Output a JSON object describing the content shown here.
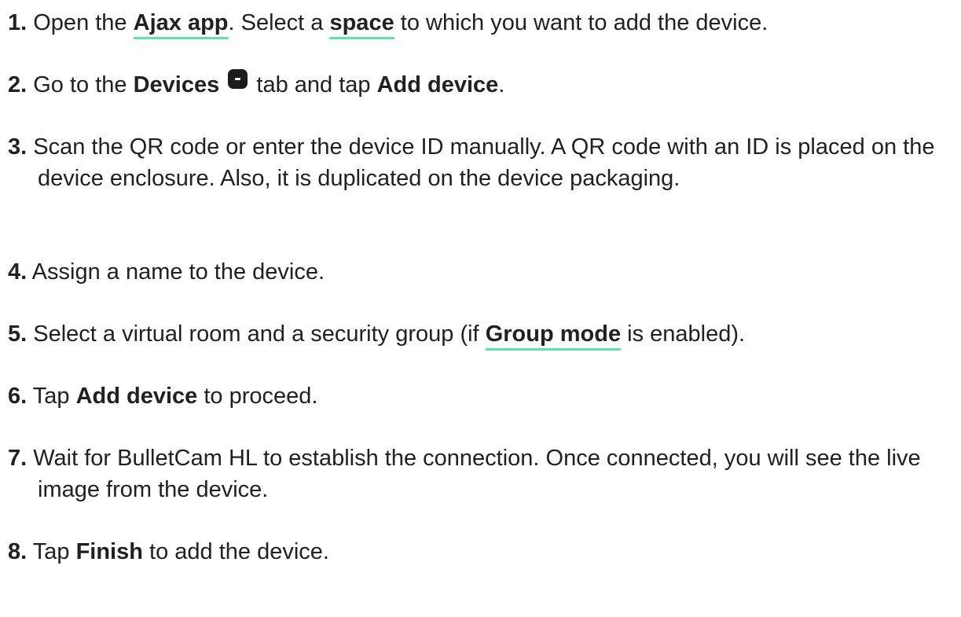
{
  "steps": [
    {
      "num": "1.",
      "t1": "Open the ",
      "link1": "Ajax app",
      "t2": ". Select a ",
      "link2": "space",
      "t3": " to which you want to add the device."
    },
    {
      "num": "2.",
      "t1": "Go to the ",
      "b1": "Devices",
      "icon": "devices-tab-icon",
      "t2": " tab and tap ",
      "b2": "Add device",
      "t3": "."
    },
    {
      "num": "3.",
      "text": "Scan the QR code or enter the device ID manually. A QR code with an ID is placed on the device enclosure. Also, it is duplicated on the device packaging."
    },
    {
      "num": "4.",
      "text": "Assign a name to the device."
    },
    {
      "num": "5.",
      "t1": "Select a virtual room and a security group (if ",
      "link1": "Group mode",
      "t2": " is enabled)."
    },
    {
      "num": "6.",
      "t1": "Tap ",
      "b1": "Add device",
      "t2": " to proceed."
    },
    {
      "num": "7.",
      "text": "Wait for BulletCam HL to establish the connection. Once connected, you will see the live image from the device."
    },
    {
      "num": "8.",
      "t1": "Tap ",
      "b1": "Finish",
      "t2": " to add the device."
    }
  ],
  "colors": {
    "text": "#212121",
    "link_underline": "#5fe0b6",
    "icon_bg": "#1c1c1c"
  }
}
